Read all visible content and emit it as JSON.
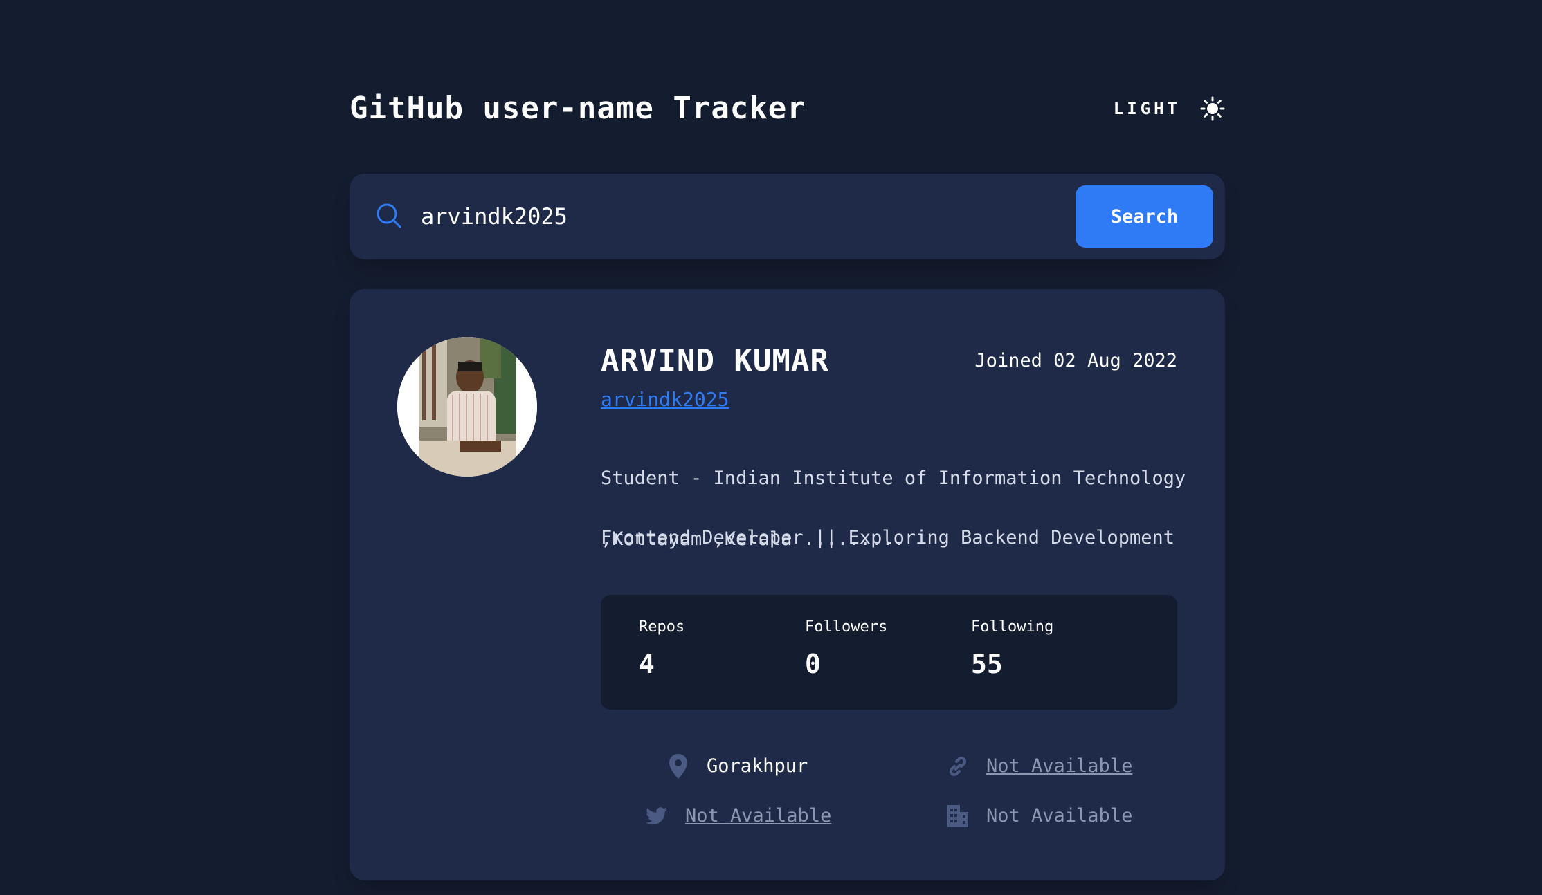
{
  "header": {
    "title": "GitHub user-name Tracker",
    "theme_label": "LIGHT",
    "theme_icon": "sun-icon"
  },
  "search": {
    "value": "arvindk2025",
    "placeholder": "arvindk2025",
    "icon": "search-icon",
    "button_label": "Search"
  },
  "profile": {
    "name": "ARVIND KUMAR",
    "joined": "Joined 02 Aug 2022",
    "login": "arvindk2025",
    "bio_lines": [
      "Student - Indian Institute of Information Technology",
      ",Kottayam ,Kerala ........."
    ],
    "tagline": "Frontend Developer || Exploring Backend Development"
  },
  "stats": [
    {
      "label": "Repos",
      "value": "4"
    },
    {
      "label": "Followers",
      "value": "0"
    },
    {
      "label": "Following",
      "value": "55"
    }
  ],
  "links": {
    "location": {
      "icon": "location-pin-icon",
      "text": "Gorakhpur"
    },
    "website": {
      "icon": "link-icon",
      "text": "Not Available"
    },
    "twitter": {
      "icon": "twitter-icon",
      "text": "Not Available"
    },
    "company": {
      "icon": "building-icon",
      "text": "Not Available"
    }
  },
  "colors": {
    "background": "#141c2f",
    "card": "#1f2a48",
    "accent": "#2f7bf5",
    "muted_icon": "#4b5a82",
    "unavailable_text": "#8b96b0"
  }
}
